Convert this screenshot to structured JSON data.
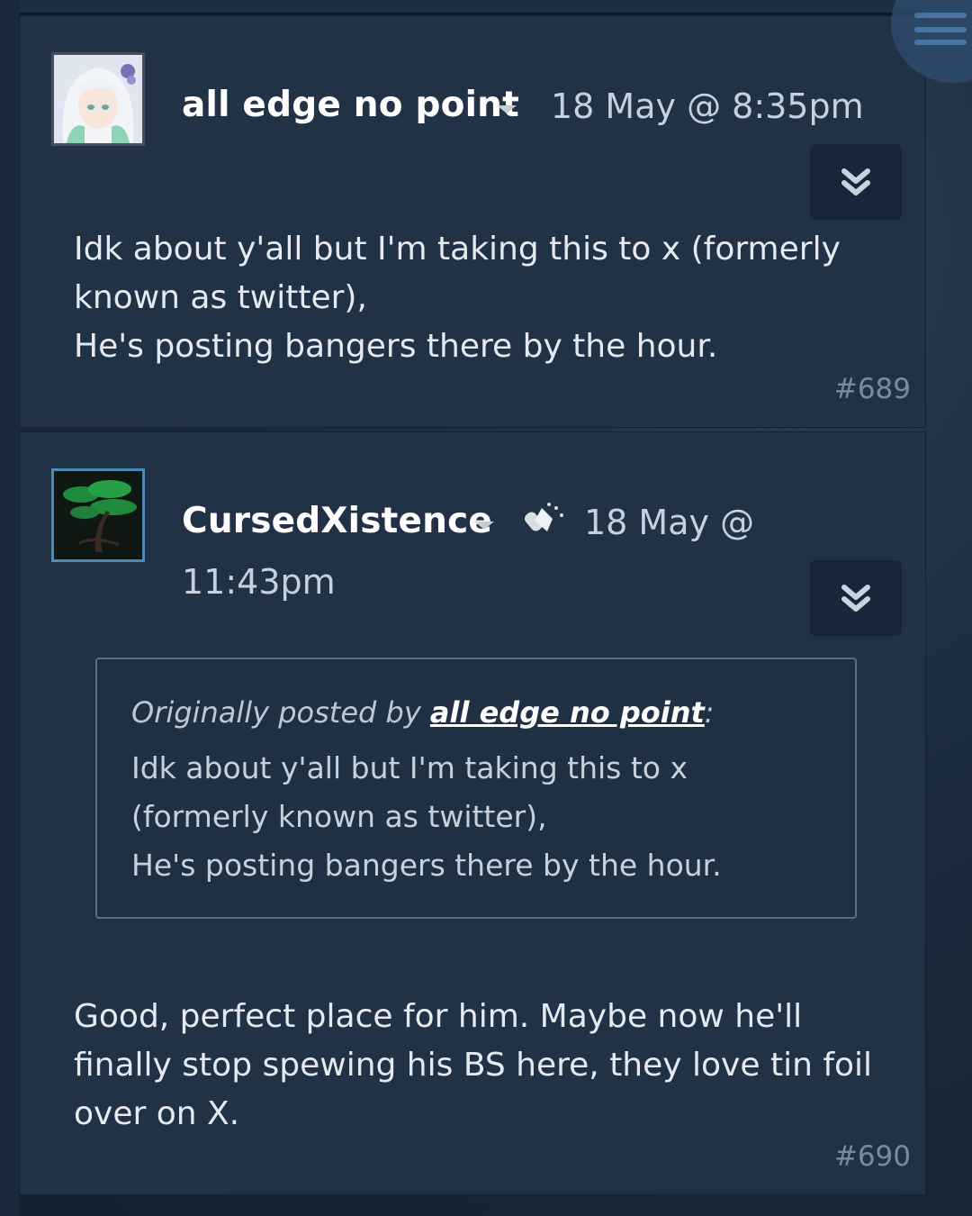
{
  "posts": [
    {
      "author": "all edge no point",
      "timestamp": "18 May @ 8:35pm",
      "lines": [
        "Idk about y'all but I'm taking this to x (formerly",
        "known as twitter),",
        "He's posting bangers there by the hour."
      ],
      "number": "#689"
    },
    {
      "author": "CursedXistence",
      "timestamp_line1": "18 May @",
      "timestamp_line2": "11:43pm",
      "quote": {
        "prefix": "Originally posted by ",
        "author": "all edge no point",
        "suffix": ":",
        "lines": [
          "Idk about y'all but I'm taking this to x",
          "(formerly known as twitter),",
          "He's posting bangers there by the hour."
        ]
      },
      "lines": [
        "Good, perfect place for him. Maybe now he'll",
        "finally stop spewing his BS here, they love tin foil",
        "over on X."
      ],
      "number": "#690"
    }
  ],
  "icons": {
    "menu": "hamburger-menu-icon",
    "collapse": "double-chevron-down-icon",
    "award": "award-icon",
    "dropdown": "caret-down-icon"
  },
  "colors": {
    "post_bg": "#213247",
    "username": "#ffffff",
    "timestamp": "#c7d0dc",
    "post_number": "#7d8a9b"
  }
}
